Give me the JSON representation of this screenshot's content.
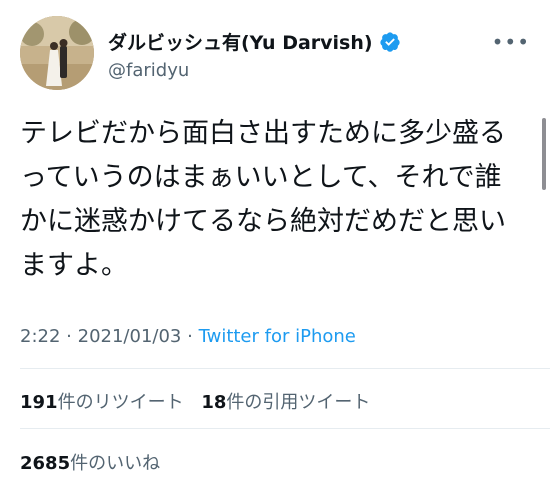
{
  "profile": {
    "display_name": "ダルビッシュ有(Yu Darvish)",
    "handle": "@faridyu",
    "verified": true,
    "more_icon": "more-horizontal-icon"
  },
  "tweet": {
    "text": "テレビだから面白さ出すために多少盛るっていうのはまぁいいとして、それで誰かに迷惑かけてるなら絶対だめだと思いますよ。",
    "time": "2:22",
    "date": "2021/01/03",
    "separator": "·",
    "source": "Twitter for iPhone"
  },
  "stats": {
    "retweets_count": "191",
    "retweets_label": "件のリツイート",
    "quotes_count": "18",
    "quotes_label": "件の引用ツイート",
    "likes_count": "2685",
    "likes_label": "件のいいね"
  },
  "colors": {
    "link": "#1d9bf0",
    "secondary_text": "#536471",
    "verified_badge": "#1d9bf0"
  }
}
